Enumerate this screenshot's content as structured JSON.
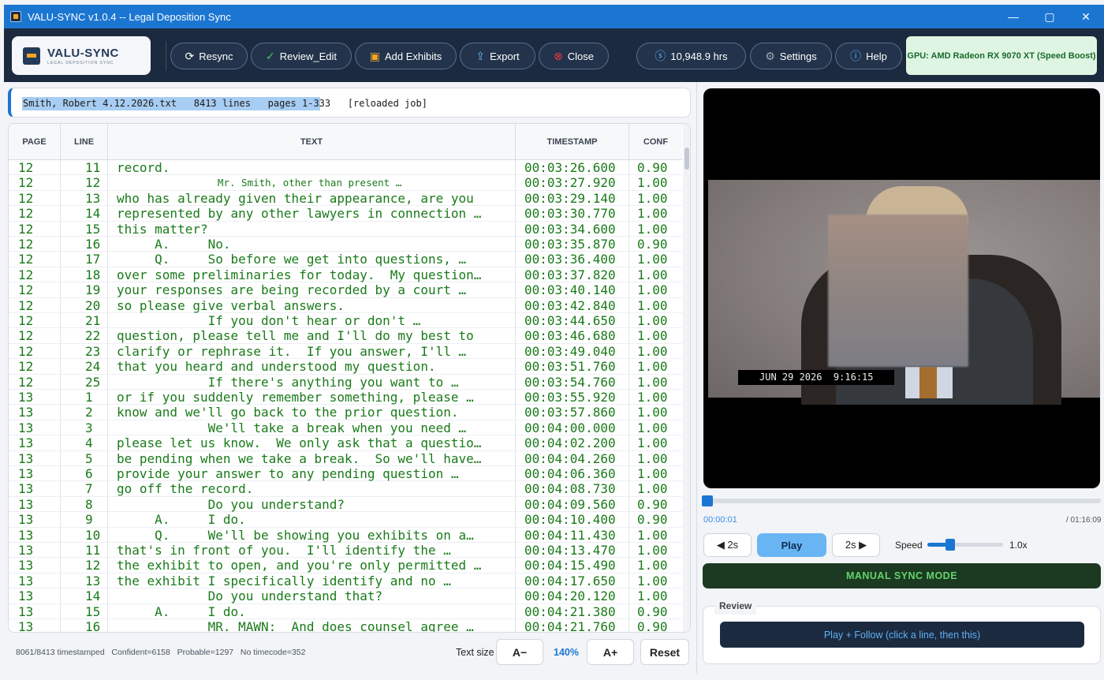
{
  "window": {
    "title": "VALU-SYNC  v1.0.4  --  Legal Deposition Sync",
    "minimize": "—",
    "maximize": "▢",
    "close": "✕"
  },
  "logo": {
    "name": "VALU-SYNC",
    "tagline": "LEGAL DEPOSITION SYNC"
  },
  "toolbar": {
    "resync": "Resync",
    "review_edit": "Review_Edit",
    "add_exhibits": "Add Exhibits",
    "export": "Export",
    "close": "Close",
    "hours": "10,948.9 hrs",
    "settings": "Settings",
    "help": "Help",
    "gpu": "GPU: AMD Radeon RX 9070 XT (Speed Boost)"
  },
  "icons": {
    "resync": "refresh-icon",
    "review_edit": "check-icon",
    "add_exhibits": "image-icon",
    "export": "upload-icon",
    "close": "close-circle-icon",
    "hours": "dollar-icon",
    "settings": "gear-icon",
    "help": "help-icon"
  },
  "colors": {
    "accent": "#1b76d2",
    "toolbar": "#1b2a3f",
    "text_green": "#1a7a1a",
    "manual_green": "#63d46c"
  },
  "file": {
    "selected": "Smith, Robert 4.12.2026.txt   8413 lines   pages 1-333",
    "suffix": "   [reloaded job]"
  },
  "table": {
    "columns": [
      "PAGE",
      "LINE",
      "TEXT",
      "TIMESTAMP",
      "CONF"
    ],
    "rows": [
      [
        "12",
        "11",
        "record.",
        "00:03:26.600",
        "0.90"
      ],
      [
        "12",
        "12",
        "                 Mr. Smith, other than present …",
        "00:03:27.920",
        "1.00"
      ],
      [
        "12",
        "13",
        "who has already given their appearance, are you",
        "00:03:29.140",
        "1.00"
      ],
      [
        "12",
        "14",
        "represented by any other lawyers in connection …",
        "00:03:30.770",
        "1.00"
      ],
      [
        "12",
        "15",
        "this matter?",
        "00:03:34.600",
        "1.00"
      ],
      [
        "12",
        "16",
        "     A.     No.",
        "00:03:35.870",
        "0.90"
      ],
      [
        "12",
        "17",
        "     Q.     So before we get into questions, …",
        "00:03:36.400",
        "1.00"
      ],
      [
        "12",
        "18",
        "over some preliminaries for today.  My question…",
        "00:03:37.820",
        "1.00"
      ],
      [
        "12",
        "19",
        "your responses are being recorded by a court …",
        "00:03:40.140",
        "1.00"
      ],
      [
        "12",
        "20",
        "so please give verbal answers.",
        "00:03:42.840",
        "1.00"
      ],
      [
        "12",
        "21",
        "            If you don't hear or don't …",
        "00:03:44.650",
        "1.00"
      ],
      [
        "12",
        "22",
        "question, please tell me and I'll do my best to",
        "00:03:46.680",
        "1.00"
      ],
      [
        "12",
        "23",
        "clarify or rephrase it.  If you answer, I'll …",
        "00:03:49.040",
        "1.00"
      ],
      [
        "12",
        "24",
        "that you heard and understood my question.",
        "00:03:51.760",
        "1.00"
      ],
      [
        "12",
        "25",
        "            If there's anything you want to …",
        "00:03:54.760",
        "1.00"
      ],
      [
        "13",
        "1",
        "or if you suddenly remember something, please …",
        "00:03:55.920",
        "1.00"
      ],
      [
        "13",
        "2",
        "know and we'll go back to the prior question.",
        "00:03:57.860",
        "1.00"
      ],
      [
        "13",
        "3",
        "            We'll take a break when you need …",
        "00:04:00.000",
        "1.00"
      ],
      [
        "13",
        "4",
        "please let us know.  We only ask that a questio…",
        "00:04:02.200",
        "1.00"
      ],
      [
        "13",
        "5",
        "be pending when we take a break.  So we'll have…",
        "00:04:04.260",
        "1.00"
      ],
      [
        "13",
        "6",
        "provide your answer to any pending question …",
        "00:04:06.360",
        "1.00"
      ],
      [
        "13",
        "7",
        "go off the record.",
        "00:04:08.730",
        "1.00"
      ],
      [
        "13",
        "8",
        "            Do you understand?",
        "00:04:09.560",
        "0.90"
      ],
      [
        "13",
        "9",
        "     A.     I do.",
        "00:04:10.400",
        "0.90"
      ],
      [
        "13",
        "10",
        "     Q.     We'll be showing you exhibits on a…",
        "00:04:11.430",
        "1.00"
      ],
      [
        "13",
        "11",
        "that's in front of you.  I'll identify the …",
        "00:04:13.470",
        "1.00"
      ],
      [
        "13",
        "12",
        "the exhibit to open, and you're only permitted …",
        "00:04:15.490",
        "1.00"
      ],
      [
        "13",
        "13",
        "the exhibit I specifically identify and no …",
        "00:04:17.650",
        "1.00"
      ],
      [
        "13",
        "14",
        "            Do you understand that?",
        "00:04:20.120",
        "1.00"
      ],
      [
        "13",
        "15",
        "     A.     I do.",
        "00:04:21.380",
        "0.90"
      ],
      [
        "13",
        "16",
        "            MR. MAWN:  And does counsel agree …",
        "00:04:21.760",
        "0.90"
      ]
    ]
  },
  "status": {
    "stats": "8061/8413 timestamped   Confident=6158   Probable=1297   No timecode=352",
    "text_size_label": "Text size",
    "decrease": "A−",
    "zoom": "140%",
    "increase": "A+",
    "reset": "Reset"
  },
  "video": {
    "overlay_timestamp": "JUN 29 2026  9:16:15",
    "current_time": "00:00:01",
    "duration": "/ 01:16:09",
    "progress": 0.0002
  },
  "playback": {
    "back": "◀ 2s",
    "play": "Play",
    "forward": "2s ▶",
    "speed_label": "Speed",
    "speed_value": "1.0x",
    "speed_level": 0.3
  },
  "manual_sync": "MANUAL SYNC MODE",
  "review": {
    "legend": "Review",
    "follow_button": "Play + Follow (click a line, then this)"
  }
}
